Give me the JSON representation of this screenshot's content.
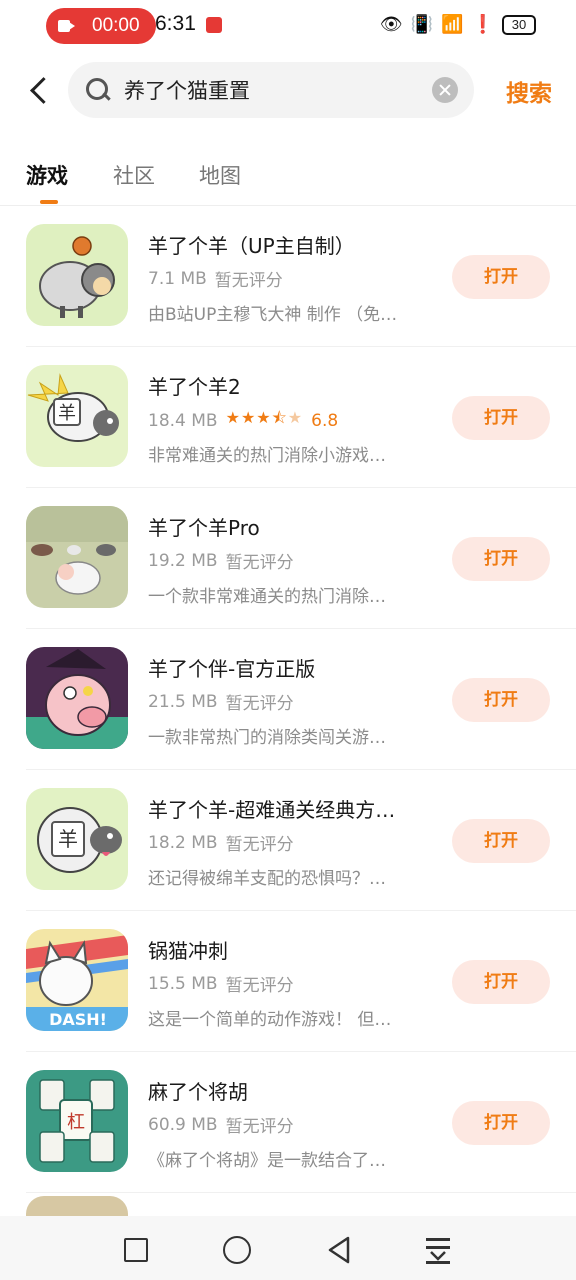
{
  "status_bar": {
    "rec_time": "00:00",
    "clock": "6:31",
    "battery": "30",
    "icons": [
      "eye-icon",
      "vibrate-icon",
      "wifi-icon",
      "alert-icon",
      "battery-icon"
    ]
  },
  "search": {
    "query": "养了个猫重置",
    "button_label": "搜索"
  },
  "tabs": [
    {
      "label": "游戏",
      "active": true
    },
    {
      "label": "社区",
      "active": false
    },
    {
      "label": "地图",
      "active": false
    }
  ],
  "apps": [
    {
      "name": "羊了个羊（UP主自制）",
      "size": "7.1 MB",
      "rating_text": "暂无评分",
      "desc": "由B站UP主穆飞大神 制作 （免…",
      "button": "打开"
    },
    {
      "name": "羊了个羊2",
      "size": "18.4 MB",
      "rating_value": "6.8",
      "stars": 3.5,
      "desc": "非常难通关的热门消除小游戏…",
      "button": "打开"
    },
    {
      "name": "羊了个羊Pro",
      "size": "19.2 MB",
      "rating_text": "暂无评分",
      "desc": "一个款非常难通关的热门消除…",
      "button": "打开"
    },
    {
      "name": "羊了个伴-官方正版",
      "size": "21.5 MB",
      "rating_text": "暂无评分",
      "desc": "一款非常热门的消除类闯关游…",
      "button": "打开"
    },
    {
      "name": "羊了个羊-超难通关经典方…",
      "size": "18.2 MB",
      "rating_text": "暂无评分",
      "desc": "还记得被绵羊支配的恐惧吗？…",
      "button": "打开"
    },
    {
      "name": "锅猫冲刺",
      "size": "15.5 MB",
      "rating_text": "暂无评分",
      "desc": "这是一个简单的动作游戏！ 但…",
      "button": "打开"
    },
    {
      "name": "麻了个将胡",
      "size": "60.9 MB",
      "rating_text": "暂无评分",
      "desc": "《麻了个将胡》是一款结合了…",
      "button": "打开"
    }
  ],
  "icon_labels": {
    "app2_tile": "羊",
    "app5_tile": "羊",
    "app6_text": "DASH!",
    "app7_tile": "杠"
  },
  "colors": {
    "accent": "#f07c14",
    "button_bg": "#fde8e2"
  }
}
